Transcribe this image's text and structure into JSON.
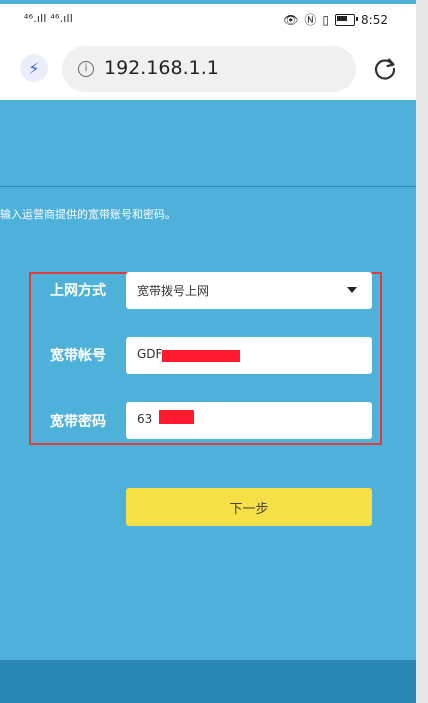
{
  "status_bar": {
    "signal_text": "⁴⁶.ıll ⁴⁶.ıll",
    "time": "8:52"
  },
  "address_bar": {
    "url": "192.168.1.1"
  },
  "form": {
    "instruction": "输入运营商提供的宽带账号和密码。",
    "connection_type": {
      "label": "上网方式",
      "selected": "宽带拨号上网"
    },
    "account": {
      "label": "宽带帐号",
      "value": "GDF"
    },
    "password": {
      "label": "宽带密码",
      "value": "63"
    },
    "next_button": "下一步"
  },
  "colors": {
    "page_background": "#4eb1da",
    "button": "#f7e046",
    "highlight_border": "#e33b3b",
    "redaction": "#ff1a2e"
  }
}
